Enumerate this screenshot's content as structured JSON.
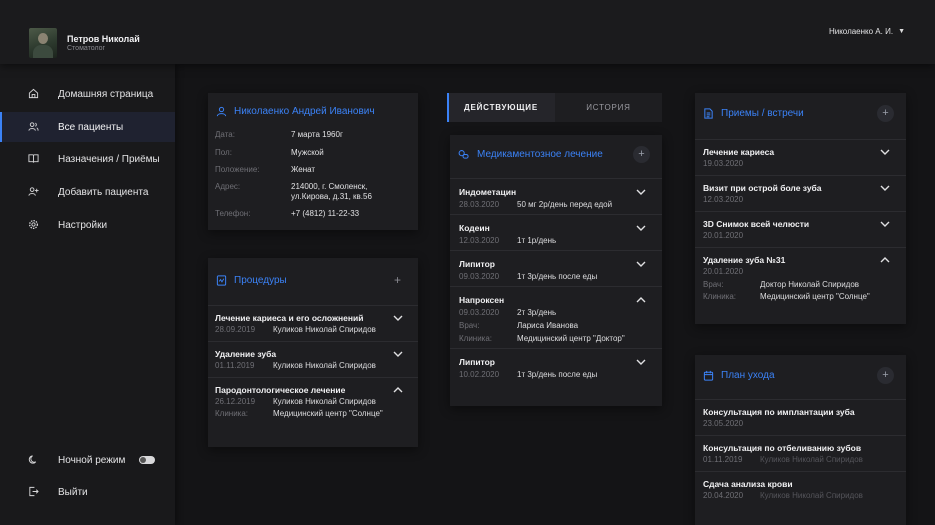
{
  "header": {
    "user_name": "Петров Николай",
    "user_role": "Стоматолог",
    "account_label": "Николаенко А. И."
  },
  "sidebar": {
    "items": [
      {
        "label": "Домашняя страница",
        "icon": "home-icon"
      },
      {
        "label": "Все пациенты",
        "icon": "users-icon",
        "active": true
      },
      {
        "label": "Назначения / Приёмы",
        "icon": "book-icon"
      },
      {
        "label": "Добавить пациента",
        "icon": "add-user-icon"
      },
      {
        "label": "Настройки",
        "icon": "gear-icon"
      }
    ],
    "night_mode_label": "Ночной режим",
    "logout_label": "Выйти"
  },
  "patient": {
    "name": "Николаенко Андрей Иванович",
    "fields": [
      {
        "label": "Дата:",
        "value": "7 марта 1960г"
      },
      {
        "label": "Пол:",
        "value": "Мужской"
      },
      {
        "label": "Положение:",
        "value": "Женат"
      },
      {
        "label": "Адрес:",
        "value": "214000, г. Смоленск,",
        "value2": "ул.Кирова, д.31, кв.56"
      },
      {
        "label": "Телефон:",
        "value": "+7 (4812) 11-22-33"
      }
    ]
  },
  "procedures": {
    "title": "Процедуры",
    "add_symbol": "+",
    "items": [
      {
        "title": "Лечение кариеса и его осложнений",
        "date": "28.09.2019",
        "doctor": "Куликов Николай Спиридов"
      },
      {
        "title": "Удаление зуба",
        "date": "01.11.2019",
        "doctor": "Куликов Николай Спиридов"
      },
      {
        "title": "Пародонтологическое лечение",
        "date": "26.12.2019",
        "doctor": "Куликов Николай Спиридов",
        "clinic_label": "Клиника:",
        "clinic": "Медицинский центр \"Солнце\""
      }
    ]
  },
  "tabs": {
    "active": "ДЕЙСТВУЮЩИЕ",
    "inactive": "ИСТОРИЯ"
  },
  "medications": {
    "title": "Медикаментозное лечение",
    "add_symbol": "+",
    "items": [
      {
        "title": "Индометацин",
        "date": "28.03.2020",
        "dose": "50 мг 2р/день перед едой"
      },
      {
        "title": "Кодеин",
        "date": "12.03.2020",
        "dose": "1т 1р/день"
      },
      {
        "title": "Липитор",
        "date": "09.03.2020",
        "dose": "1т 3р/день после еды"
      },
      {
        "title": "Напроксен",
        "date": "09.03.2020",
        "dose": "2т 3р/день",
        "doctor_label": "Врач:",
        "doctor": "Лариса Иванова",
        "clinic_label": "Клиника:",
        "clinic": "Медицинский центр \"Доктор\""
      },
      {
        "title": "Липитор",
        "date": "10.02.2020",
        "dose": "1т 3р/день после еды"
      }
    ]
  },
  "appointments": {
    "title": "Приемы / встречи",
    "add_symbol": "+",
    "items": [
      {
        "title": "Лечение кариеса",
        "date": "19.03.2020"
      },
      {
        "title": "Визит при острой боле зуба",
        "date": "12.03.2020"
      },
      {
        "title": "3D Снимок всей челюсти",
        "date": "20.01.2020"
      },
      {
        "title": "Удаление зуба №31",
        "date": "20.01.2020",
        "doctor_label": "Врач:",
        "doctor": "Доктор Николай Спиридов",
        "clinic_label": "Клиника:",
        "clinic": "Медицинский центр \"Солнце\""
      }
    ]
  },
  "care_plan": {
    "title": "План ухода",
    "add_symbol": "+",
    "items": [
      {
        "title": "Консультация по имплантации зуба",
        "date": "23.05.2020"
      },
      {
        "title": "Консультация по отбеливанию зубов",
        "date": "01.11.2019",
        "doctor": "Куликов Николай Спиридов"
      },
      {
        "title": "Сдача анализа крови",
        "date": "20.04.2020",
        "doctor": "Куликов Николай Спиридов"
      }
    ]
  },
  "colors": {
    "accent": "#3b82f6",
    "background": "#141416",
    "card": "#1e1e21"
  }
}
